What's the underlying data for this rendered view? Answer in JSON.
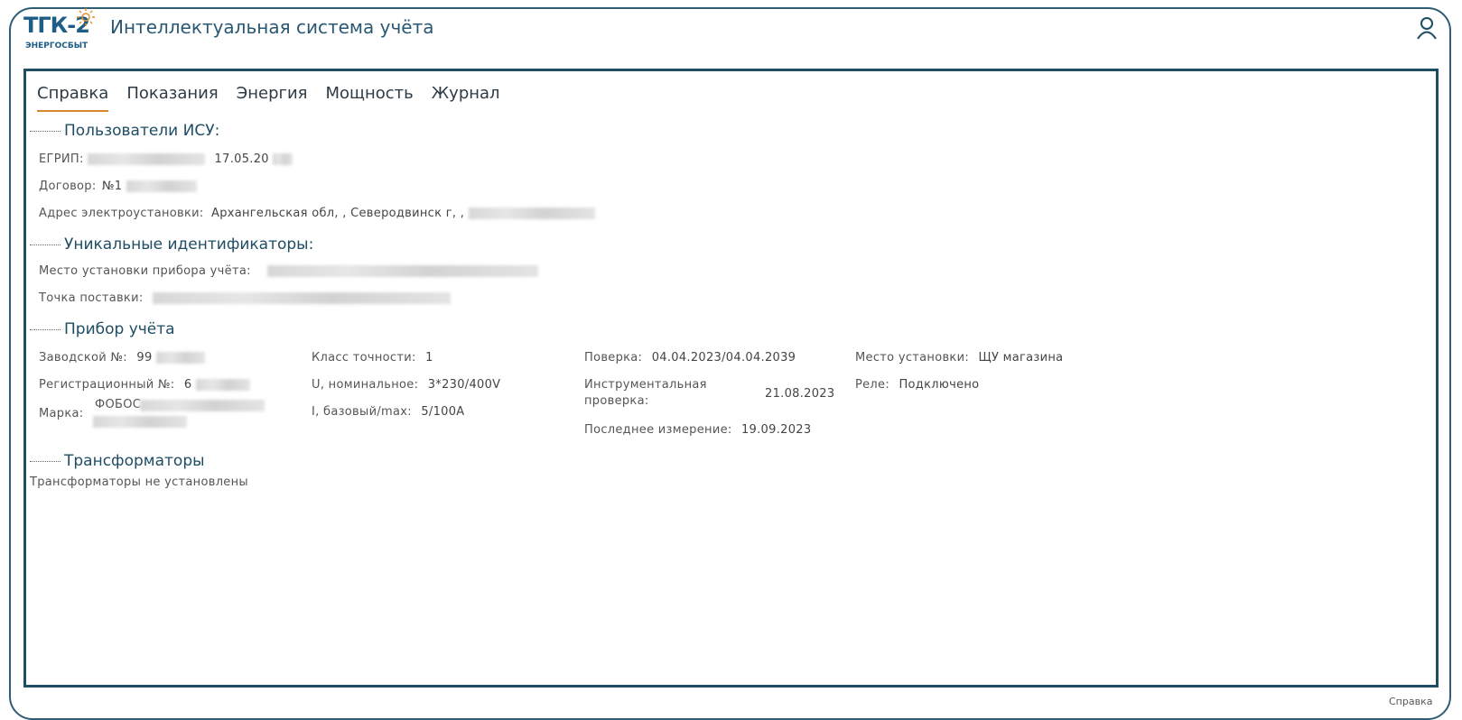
{
  "header": {
    "logo_text": "ТГК-2",
    "logo_subtext": "ЭНЕРГОСБЫТ",
    "title": "Интеллектуальная система учёта"
  },
  "tabs": [
    {
      "label": "Справка",
      "active": true
    },
    {
      "label": "Показания",
      "active": false
    },
    {
      "label": "Энергия",
      "active": false
    },
    {
      "label": "Мощность",
      "active": false
    },
    {
      "label": "Журнал",
      "active": false
    }
  ],
  "users": {
    "heading": "Пользователи ИСУ:",
    "egrip_label": "ЕГРИП:",
    "egrip_value": "17.05.20",
    "contract_label": "Договор:",
    "contract_value": "№1",
    "address_label": "Адрес электроустановки:",
    "address_value": "Архангельская обл, , Северодвинск г, ,"
  },
  "ids": {
    "heading": "Уникальные идентификаторы:",
    "place_label": "Место установки прибора учёта:",
    "point_label": "Точка поставки:"
  },
  "meter": {
    "heading": "Прибор учёта",
    "serial_label": "Заводской №:",
    "serial_value": "99",
    "reg_label": "Регистрационный №:",
    "reg_value": "6",
    "brand_label": "Марка:",
    "brand_value": "ФОБОС",
    "accuracy_label": "Класс точности:",
    "accuracy_value": "1",
    "u_label": "U, номинальное:",
    "u_value": "3*230/400V",
    "i_label": "I, базовый/max:",
    "i_value": "5/100A",
    "check_label": "Поверка:",
    "check_value": "04.04.2023/04.04.2039",
    "instr_label_1": "Инструментальная",
    "instr_label_2": "проверка:",
    "instr_value": "21.08.2023",
    "last_label": "Последнее измерение:",
    "last_value": "19.09.2023",
    "install_label": "Место установки:",
    "install_value": "ЩУ магазина",
    "relay_label": "Реле:",
    "relay_value": "Подключено"
  },
  "transformers": {
    "heading": "Трансформаторы",
    "text": "Трансформаторы не установлены"
  },
  "footer": {
    "link": "Справка"
  },
  "colors": {
    "accent": "#d9872b",
    "frame": "#1e4d64",
    "heading": "#1e4d64"
  }
}
